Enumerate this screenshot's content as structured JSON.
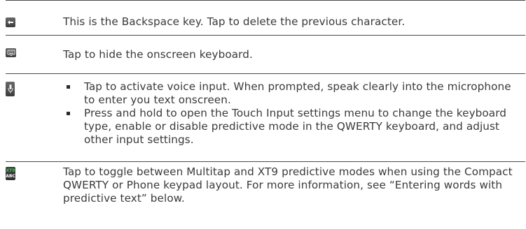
{
  "rows": [
    {
      "icon": "backspace-icon",
      "text": "This is the Backspace key. Tap to delete the previous character."
    },
    {
      "icon": "hide-keyboard-icon",
      "text": "Tap to hide the onscreen keyboard."
    },
    {
      "icon": "microphone-icon",
      "bullets": [
        "Tap to activate voice input. When prompted, speak clearly into the microphone to enter you text onscreen.",
        "Press and hold to open the Touch Input settings menu to change the keyboard type, enable or disable predictive mode in the QWERTY keyboard, and adjust other input settings."
      ]
    },
    {
      "icon": "xt9-abc-toggle-icon",
      "icon_labels": [
        "XT9",
        "ABC"
      ],
      "text": "Tap to toggle between Multitap and XT9 predictive modes when using the Compact QWERTY or Phone keypad layout. For more information, see “Entering words with predictive text” below."
    }
  ],
  "colors": {
    "rule": "#4a4a4a",
    "text": "#3a3a3a",
    "xt9_green": "#3cc850",
    "abc_white": "#ffffff"
  }
}
